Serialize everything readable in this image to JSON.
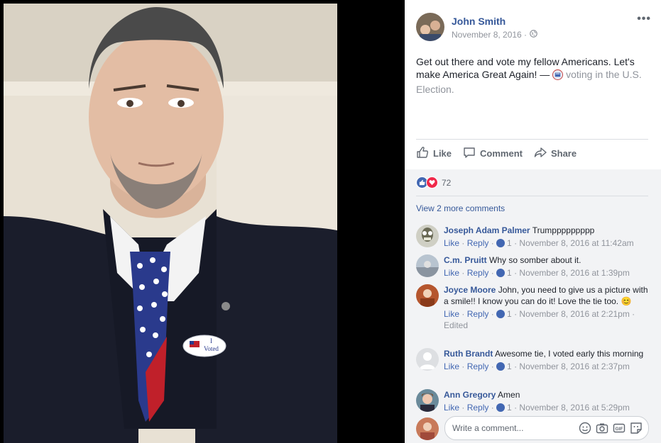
{
  "post": {
    "author": "John Smith",
    "date": "November 8, 2016 ·",
    "more": "•••",
    "text": "Get out there and vote my fellow Americans. Let's make America Great Again! —",
    "activity": "voting in the U.S. Election."
  },
  "actions": {
    "like": "Like",
    "comment": "Comment",
    "share": "Share"
  },
  "reactions": {
    "count": "72"
  },
  "view_more": "View 2 more comments",
  "comments": [
    {
      "name": "Joseph Adam Palmer",
      "text": "Trumppppppppp",
      "like": "Like",
      "reply": "Reply",
      "likes": "1",
      "time": "November 8, 2016 at 11:42am"
    },
    {
      "name": "C.m. Pruitt",
      "text": "Why so somber about it.",
      "like": "Like",
      "reply": "Reply",
      "likes": "1",
      "time": "November 8, 2016 at 1:39pm"
    },
    {
      "name": "Joyce Moore",
      "text": "John, you need to give us a picture with a smile!! I know you can do it! Love the tie too. 😊",
      "like": "Like",
      "reply": "Reply",
      "likes": "1",
      "time": "November 8, 2016 at 2:21pm ·",
      "edited": "Edited"
    },
    {
      "name": "Ruth Brandt",
      "text": "Awesome tie, I voted early this morning",
      "like": "Like",
      "reply": "Reply",
      "likes": "1",
      "time": "November 8, 2016 at 2:37pm"
    },
    {
      "name": "Ann Gregory",
      "text": "Amen",
      "like": "Like",
      "reply": "Reply",
      "likes": "1",
      "time": "November 8, 2016 at 5:29pm"
    }
  ],
  "composer": {
    "placeholder": "Write a comment..."
  },
  "photo": {
    "sticker_text": "I Voted"
  },
  "colors": {
    "link": "#365899",
    "accent": "#4267b2",
    "muted": "#90949c"
  },
  "icons": [
    "globe-icon",
    "like-icon",
    "comment-icon",
    "share-icon",
    "love-icon",
    "emoji-icon",
    "camera-icon",
    "gif-icon",
    "sticker-icon"
  ]
}
